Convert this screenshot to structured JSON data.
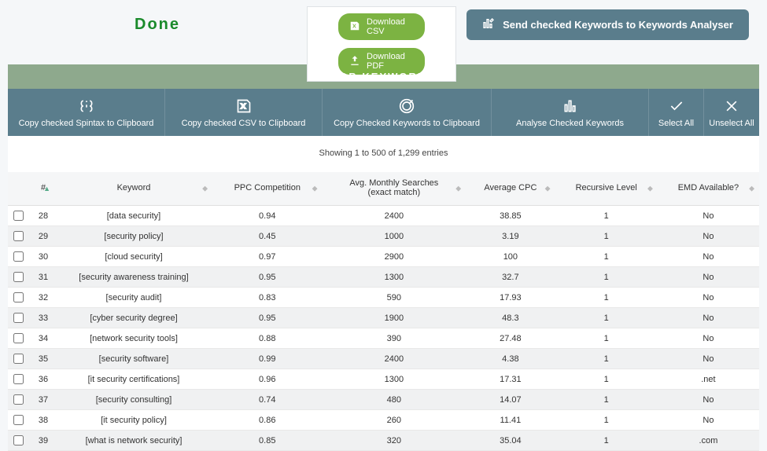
{
  "status_text": "Done",
  "download": {
    "csv_label": "Download CSV",
    "pdf_label": "Download PDF"
  },
  "send_button_label": "Send checked Keywords to Keywords Analyser",
  "section_title": "JOB KEYWORDS",
  "actions": {
    "spintax": "Copy checked Spintax to Clipboard",
    "csv": "Copy checked CSV to Clipboard",
    "keywords": "Copy Checked Keywords to Clipboard",
    "analyse": "Analyse Checked Keywords",
    "select_all": "Select All",
    "unselect_all": "Unselect All"
  },
  "entries_info": "Showing 1 to 500 of 1,299 entries",
  "columns": {
    "num": "#",
    "keyword": "Keyword",
    "ppc": "PPC Competition",
    "searches": "Avg. Monthly Searches\n(exact match)",
    "cpc": "Average CPC",
    "recursive": "Recursive Level",
    "emd": "EMD Available?"
  },
  "rows": [
    {
      "num": 28,
      "keyword": "[data security]",
      "ppc": "0.94",
      "searches": "2400",
      "cpc": "38.85",
      "recursive": "1",
      "emd": "No"
    },
    {
      "num": 29,
      "keyword": "[security policy]",
      "ppc": "0.45",
      "searches": "1000",
      "cpc": "3.19",
      "recursive": "1",
      "emd": "No"
    },
    {
      "num": 30,
      "keyword": "[cloud security]",
      "ppc": "0.97",
      "searches": "2900",
      "cpc": "100",
      "recursive": "1",
      "emd": "No"
    },
    {
      "num": 31,
      "keyword": "[security awareness training]",
      "ppc": "0.95",
      "searches": "1300",
      "cpc": "32.7",
      "recursive": "1",
      "emd": "No"
    },
    {
      "num": 32,
      "keyword": "[security audit]",
      "ppc": "0.83",
      "searches": "590",
      "cpc": "17.93",
      "recursive": "1",
      "emd": "No"
    },
    {
      "num": 33,
      "keyword": "[cyber security degree]",
      "ppc": "0.95",
      "searches": "1900",
      "cpc": "48.3",
      "recursive": "1",
      "emd": "No"
    },
    {
      "num": 34,
      "keyword": "[network security tools]",
      "ppc": "0.88",
      "searches": "390",
      "cpc": "27.48",
      "recursive": "1",
      "emd": "No"
    },
    {
      "num": 35,
      "keyword": "[security software]",
      "ppc": "0.99",
      "searches": "2400",
      "cpc": "4.38",
      "recursive": "1",
      "emd": "No"
    },
    {
      "num": 36,
      "keyword": "[it security certifications]",
      "ppc": "0.96",
      "searches": "1300",
      "cpc": "17.31",
      "recursive": "1",
      "emd": ".net"
    },
    {
      "num": 37,
      "keyword": "[security consulting]",
      "ppc": "0.74",
      "searches": "480",
      "cpc": "14.07",
      "recursive": "1",
      "emd": "No"
    },
    {
      "num": 38,
      "keyword": "[it security policy]",
      "ppc": "0.86",
      "searches": "260",
      "cpc": "11.41",
      "recursive": "1",
      "emd": "No"
    },
    {
      "num": 39,
      "keyword": "[what is network security]",
      "ppc": "0.85",
      "searches": "320",
      "cpc": "35.04",
      "recursive": "1",
      "emd": ".com"
    }
  ]
}
